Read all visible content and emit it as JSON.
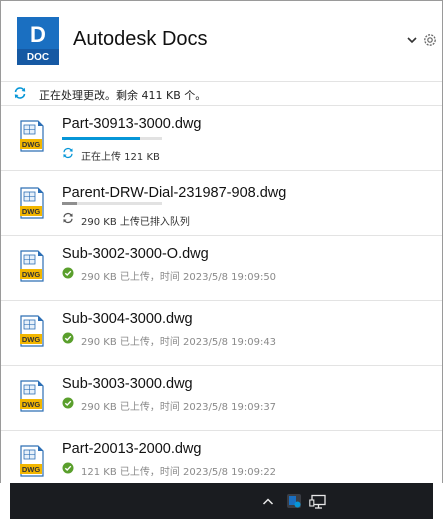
{
  "app": {
    "title": "Autodesk Docs",
    "logo_letter": "D",
    "logo_caption": "DOC"
  },
  "header_icons": {
    "expand": "chevron-down-icon",
    "settings": "gear-icon"
  },
  "status": {
    "text": "正在处理更改。剩余 411 KB 个。",
    "icon": "sync-icon"
  },
  "colors": {
    "accent": "#0696d7",
    "success": "#5a9f2c",
    "logo_blue": "#1a6fc1",
    "dwg_yellow": "#f2b600"
  },
  "files": [
    {
      "name": "Part-30913-3000.dwg",
      "state": "uploading",
      "progress": 0.78,
      "status_text": "正在上传 121 KB",
      "icon": "sync-icon"
    },
    {
      "name": "Parent-DRW-Dial-231987-908.dwg",
      "state": "queued",
      "progress": 0.15,
      "status_text": "290 KB 上传已排入队列",
      "icon": "sync-icon"
    },
    {
      "name": "Sub-3002-3000-O.dwg",
      "state": "done",
      "status_text": "290 KB 已上传，时间 2023/5/8 19:09:50",
      "icon": "check-circle-icon"
    },
    {
      "name": "Sub-3004-3000.dwg",
      "state": "done",
      "status_text": "290 KB 已上传，时间 2023/5/8 19:09:43",
      "icon": "check-circle-icon"
    },
    {
      "name": "Sub-3003-3000.dwg",
      "state": "done",
      "status_text": "290 KB 已上传，时间 2023/5/8 19:09:37",
      "icon": "check-circle-icon"
    },
    {
      "name": "Part-20013-2000.dwg",
      "state": "done",
      "status_text": "121 KB 已上传，时间 2023/5/8 19:09:22",
      "icon": "check-circle-icon"
    }
  ],
  "dwg_label": "DWG",
  "taskbar": {
    "icons": [
      "chevron-up-icon",
      "autodesk-docs-tray-icon",
      "network-icon"
    ]
  }
}
